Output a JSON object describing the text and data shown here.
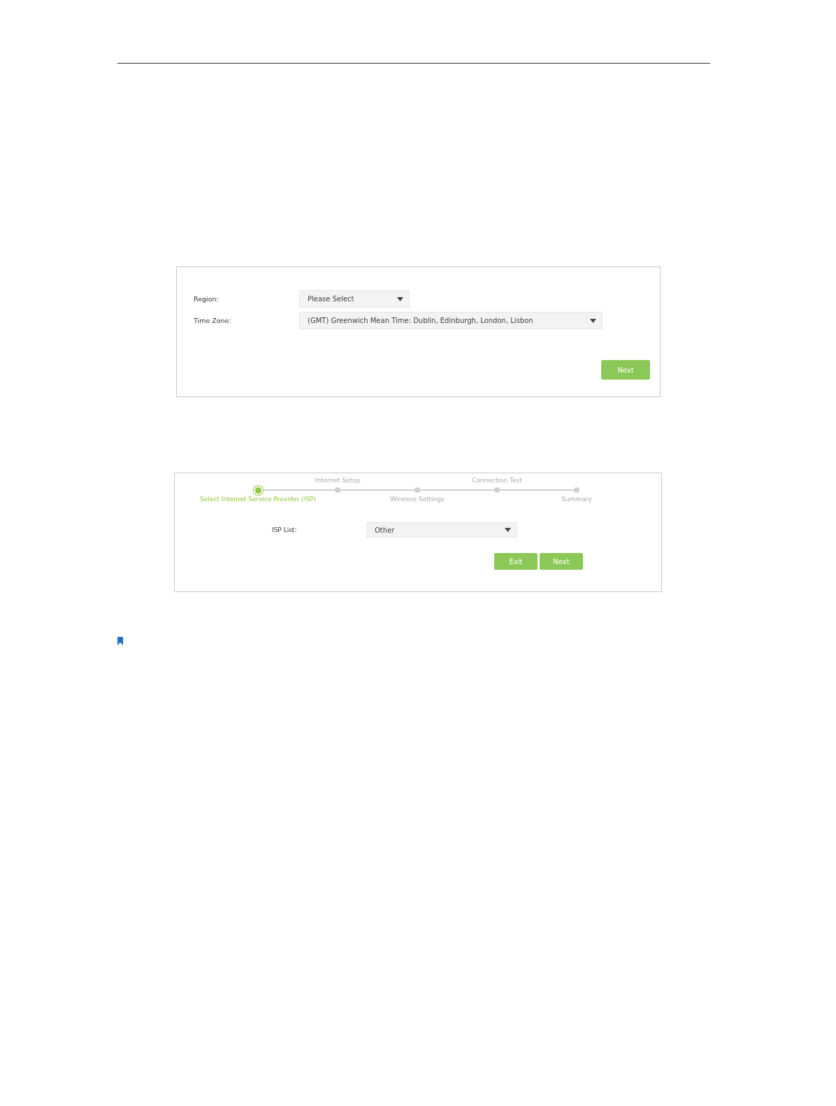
{
  "region_panel": {
    "fields": [
      {
        "label": "Region:",
        "value": "Please Select",
        "kind": "short"
      },
      {
        "label": "Time Zone:",
        "value": "(GMT) Greenwich Mean Time: Dublin, Edinburgh, London, Lisbon",
        "kind": "wide"
      }
    ],
    "buttons": [
      "Next"
    ]
  },
  "isp_panel": {
    "steps": [
      {
        "label": "Select Internet Service Provider (ISP)",
        "kind": "bottom",
        "selected": true
      },
      {
        "label": "Internet Setup",
        "kind": "top",
        "selected": false
      },
      {
        "label": "Wireless Settings",
        "kind": "bottom",
        "selected": false
      },
      {
        "label": "Connection Test",
        "kind": "top",
        "selected": false
      },
      {
        "label": "Summary",
        "kind": "bottom",
        "selected": false
      }
    ],
    "field": {
      "label": "ISP List:",
      "value": "Other"
    },
    "buttons": [
      "Exit",
      "Next"
    ]
  }
}
